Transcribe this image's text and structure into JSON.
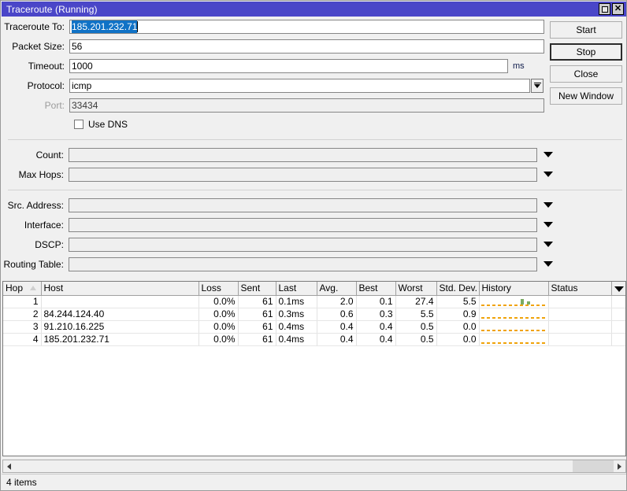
{
  "window": {
    "title": "Traceroute (Running)",
    "controls": {
      "maximize": "maximize-restore",
      "close": "close"
    }
  },
  "buttons": {
    "start": "Start",
    "stop": "Stop",
    "close": "Close",
    "new_window": "New Window"
  },
  "form": {
    "traceroute_to": {
      "label": "Traceroute To:",
      "value": "185.201.232.71",
      "selected": true
    },
    "packet_size": {
      "label": "Packet Size:",
      "value": "56"
    },
    "timeout": {
      "label": "Timeout:",
      "value": "1000",
      "unit": "ms"
    },
    "protocol": {
      "label": "Protocol:",
      "value": "icmp"
    },
    "port": {
      "label": "Port:",
      "value": "33434",
      "disabled": true
    },
    "use_dns": {
      "label": "Use DNS",
      "checked": false
    },
    "count": {
      "label": "Count:",
      "value": ""
    },
    "max_hops": {
      "label": "Max Hops:",
      "value": ""
    },
    "src_address": {
      "label": "Src. Address:",
      "value": ""
    },
    "interface": {
      "label": "Interface:",
      "value": ""
    },
    "dscp": {
      "label": "DSCP:",
      "value": ""
    },
    "routing_table": {
      "label": "Routing Table:",
      "value": ""
    }
  },
  "table": {
    "columns": [
      "Hop",
      "Host",
      "Loss",
      "Sent",
      "Last",
      "Avg.",
      "Best",
      "Worst",
      "Std. Dev.",
      "History",
      "Status"
    ],
    "sort_column": "Hop",
    "sort_direction": "ascending",
    "rows": [
      {
        "hop": "1",
        "host": "",
        "loss": "0.0%",
        "sent": "61",
        "last": "0.1ms",
        "avg": "2.0",
        "best": "0.1",
        "worst": "27.4",
        "stddev": "5.5",
        "status": "",
        "history_bars": [
          52,
          60
        ]
      },
      {
        "hop": "2",
        "host": "84.244.124.40",
        "loss": "0.0%",
        "sent": "61",
        "last": "0.3ms",
        "avg": "0.6",
        "best": "0.3",
        "worst": "5.5",
        "stddev": "0.9",
        "status": "",
        "history_bars": []
      },
      {
        "hop": "3",
        "host": "91.210.16.225",
        "loss": "0.0%",
        "sent": "61",
        "last": "0.4ms",
        "avg": "0.4",
        "best": "0.4",
        "worst": "0.5",
        "stddev": "0.0",
        "status": "",
        "history_bars": []
      },
      {
        "hop": "4",
        "host": "185.201.232.71",
        "loss": "0.0%",
        "sent": "61",
        "last": "0.4ms",
        "avg": "0.4",
        "best": "0.4",
        "worst": "0.5",
        "stddev": "0.0",
        "status": "",
        "history_bars": []
      }
    ]
  },
  "statusbar": {
    "text": "4 items"
  },
  "colors": {
    "titlebar": "#4a46c8",
    "selection": "#1072c6",
    "history_baseline": "#f0a30a",
    "history_bar": "#7aab63",
    "window_face": "#f0f0f0"
  }
}
